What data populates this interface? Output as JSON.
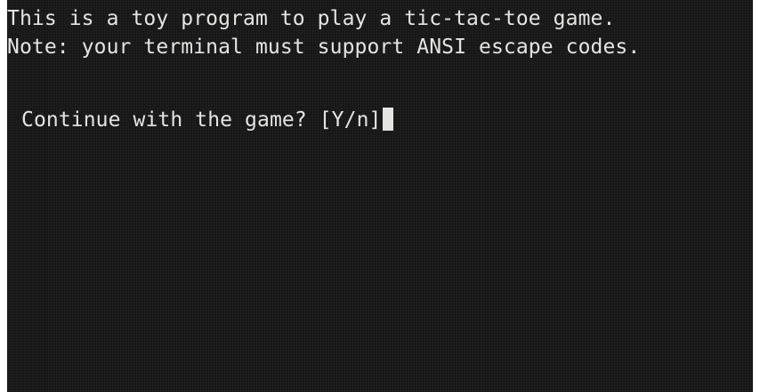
{
  "terminal": {
    "lines": [
      "This is a toy program to play a tic-tac-toe game.",
      "Note: your terminal must support ANSI escape codes.",
      ""
    ],
    "prompt": "Continue with the game? [Y/n]",
    "colors": {
      "background": "#161716",
      "foreground": "#e4e4e2"
    }
  }
}
